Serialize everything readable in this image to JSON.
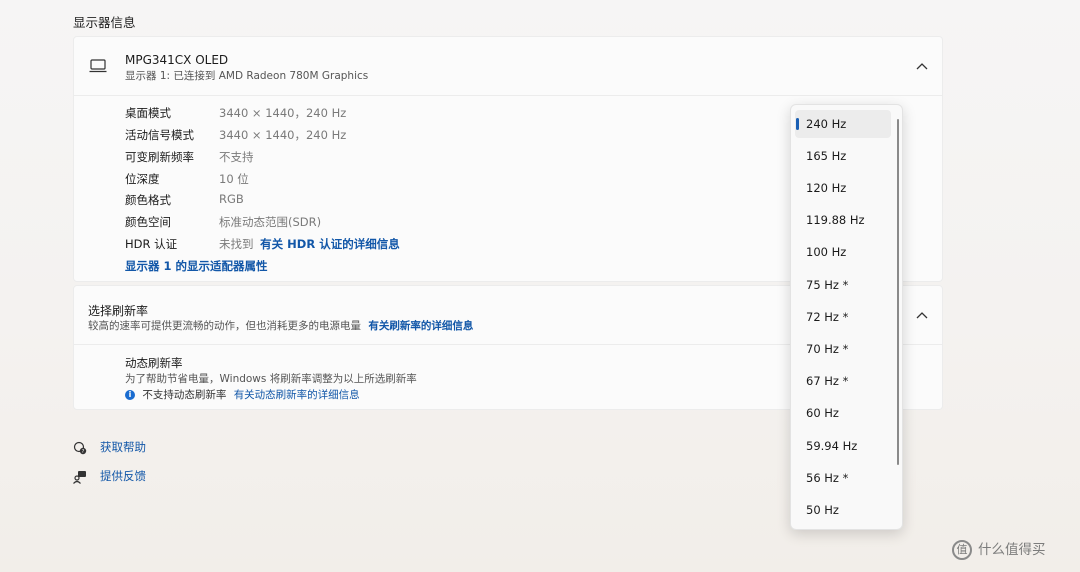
{
  "section_title": "显示器信息",
  "monitor": {
    "name": "MPG341CX OLED",
    "subtitle": "显示器 1: 已连接到 AMD Radeon 780M Graphics",
    "icon": "monitor-icon",
    "rows": [
      {
        "label": "桌面模式",
        "value": "3440 × 1440，240 Hz"
      },
      {
        "label": "活动信号模式",
        "value": "3440 × 1440，240 Hz"
      },
      {
        "label": "可变刷新频率",
        "value": "不支持"
      },
      {
        "label": "位深度",
        "value": "10 位"
      },
      {
        "label": "颜色格式",
        "value": "RGB"
      },
      {
        "label": "颜色空间",
        "value": "标准动态范围(SDR)"
      }
    ],
    "hdr_label": "HDR 认证",
    "hdr_value": "未找到",
    "hdr_link": "有关 HDR 认证的详细信息",
    "adapter_link": "显示器 1 的显示适配器属性"
  },
  "refresh_rate": {
    "title": "选择刷新率",
    "description": "较高的速率可提供更流畅的动作，但也消耗更多的电源电量",
    "description_link": "有关刷新率的详细信息",
    "dynamic_title": "动态刷新率",
    "dynamic_description": "为了帮助节省电量，Windows 将刷新率调整为以上所选刷新率",
    "dynamic_note": "不支持动态刷新率",
    "dynamic_note_link": "有关动态刷新率的详细信息"
  },
  "dropdown": {
    "selected": "240 Hz",
    "options": [
      "240 Hz",
      "165 Hz",
      "120 Hz",
      "119.88 Hz",
      "100 Hz",
      "75 Hz *",
      "72 Hz *",
      "70 Hz *",
      "67 Hz *",
      "60 Hz",
      "59.94 Hz",
      "56 Hz *",
      "50 Hz"
    ]
  },
  "footer": {
    "help": "获取帮助",
    "feedback": "提供反馈"
  },
  "watermark": "什么值得买",
  "colors": {
    "accent": "#1257a8",
    "selected_bar": "#1a5fb4"
  }
}
